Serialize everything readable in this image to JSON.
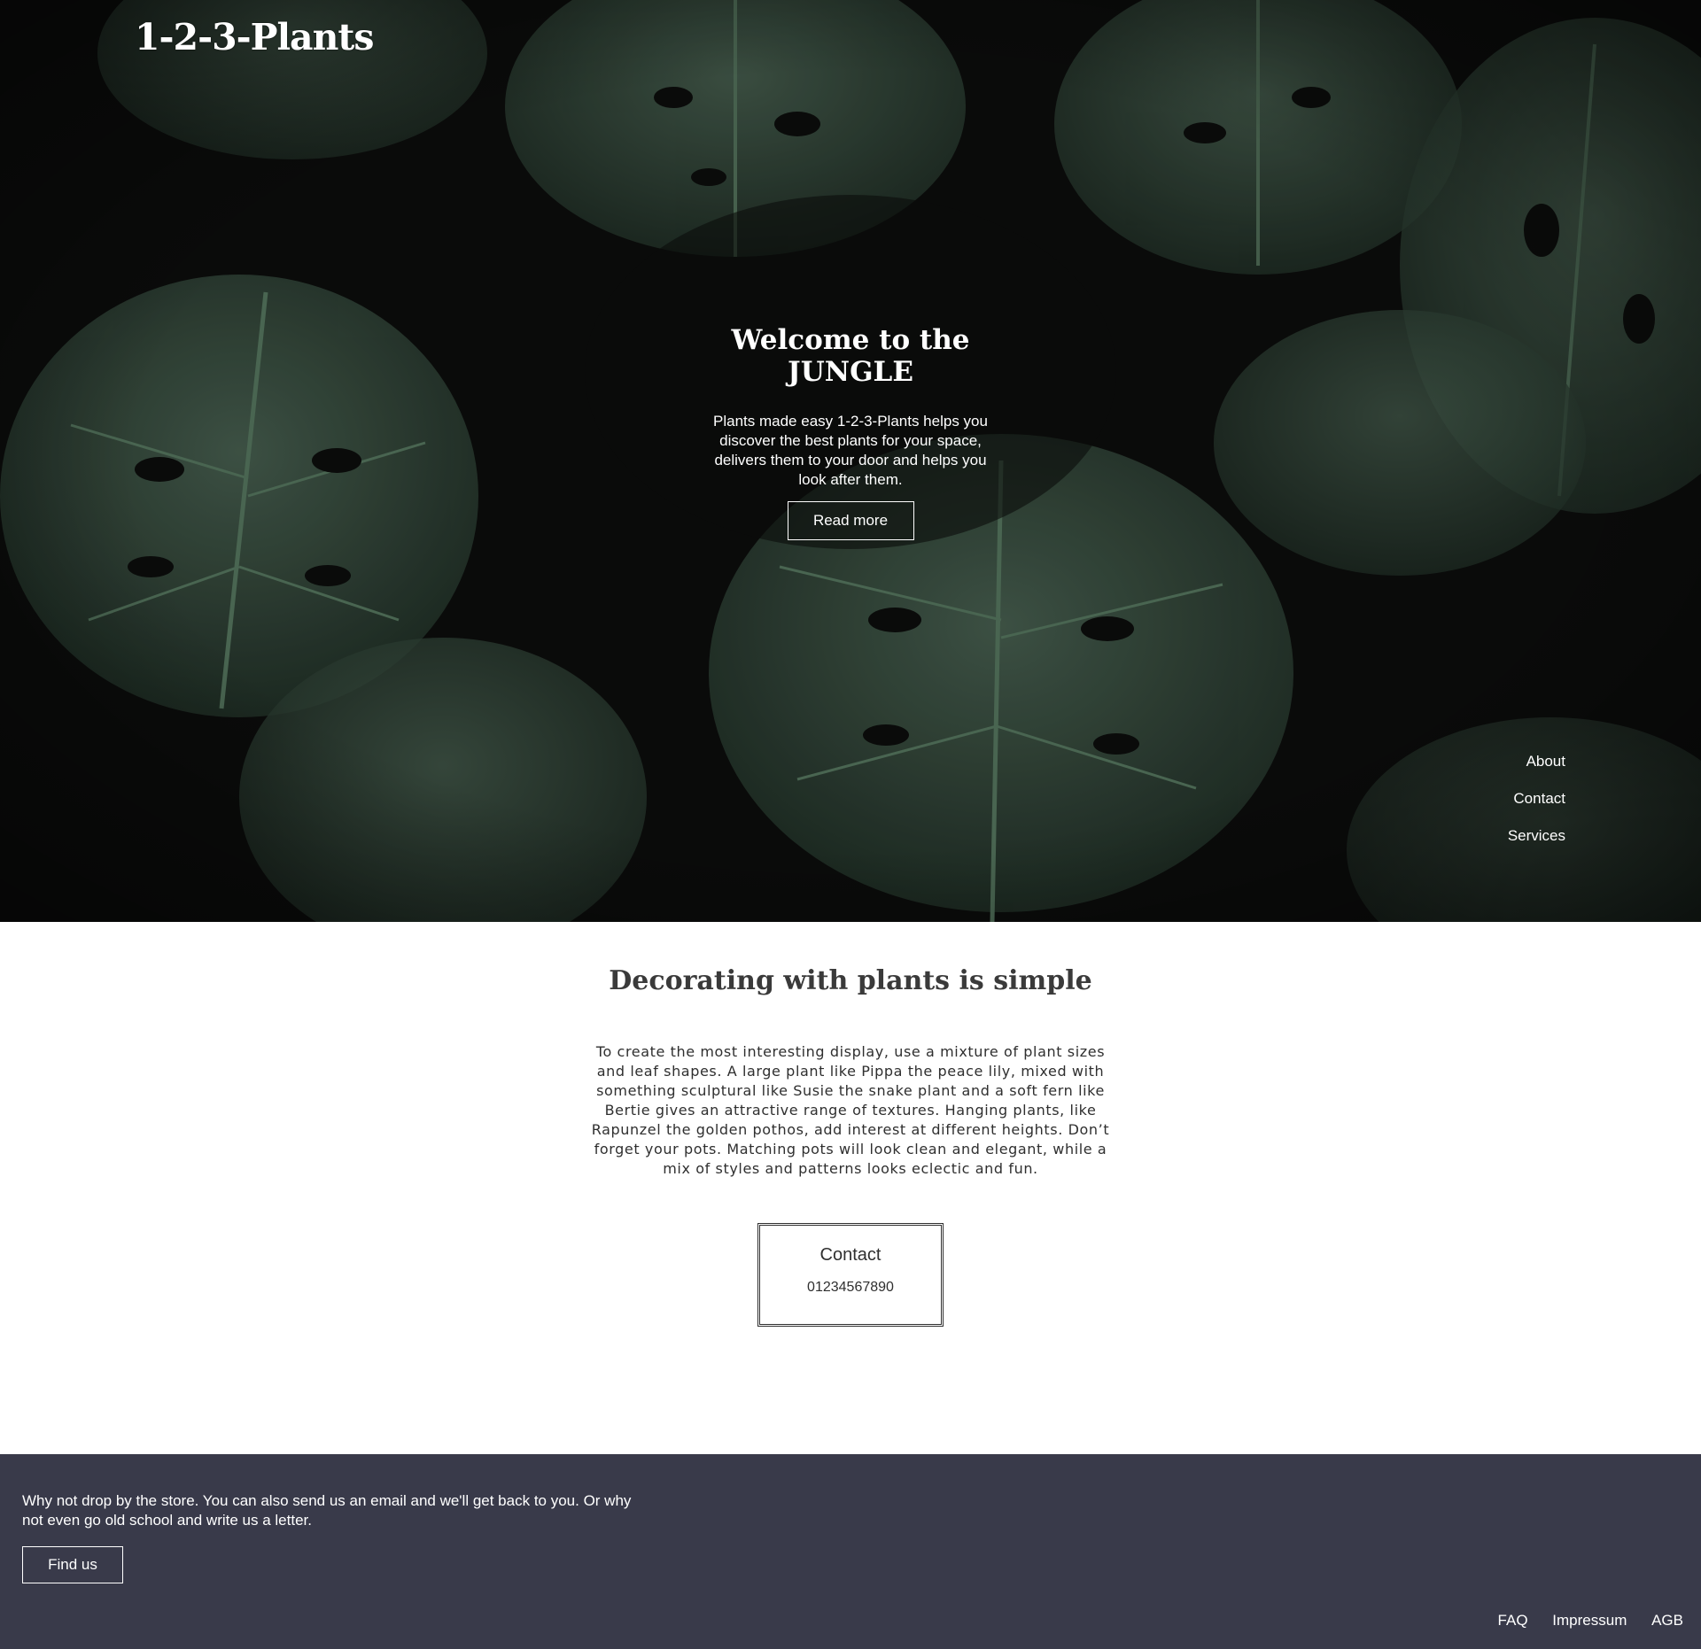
{
  "hero": {
    "logo": "1-2-3-Plants",
    "title_line1": "Welcome to the",
    "title_line2": "JUNGLE",
    "text": "Plants made easy 1-2-3-Plants helps you discover the best plants for your space, delivers them to your door and helps you look after them.",
    "button_label": "Read more",
    "background": "dark-monstera-leaves-photo",
    "nav": [
      "About",
      "Contact",
      "Services"
    ]
  },
  "main": {
    "title": "Decorating with plants is simple",
    "text": "To create the most interesting display, use a mixture of plant sizes and leaf shapes. A large plant like Pippa the peace lily, mixed with something sculptural like Susie the snake plant and a soft fern like Bertie gives an attractive range of textures. Hanging plants, like Rapunzel the golden pothos, add interest at different heights. Don’t forget your pots. Matching pots will look clean and elegant, while a mix of styles and patterns looks eclectic and fun.",
    "contact_label": "Contact",
    "contact_phone": "01234567890"
  },
  "footer": {
    "text": "Why not drop by the store. You can also send us an email and we'll get back to you. Or why not even go old school and write us a letter.",
    "button_label": "Find us",
    "links": [
      "FAQ",
      "Impressum",
      "AGB"
    ]
  },
  "colors": {
    "hero_bg": "#0a0b0a",
    "leaf_dark": "#1d2a22",
    "leaf_mid": "#2c3d33",
    "leaf_light": "#3f5446",
    "footer_bg": "#393a4a",
    "text_dark": "#2f2f2f"
  }
}
